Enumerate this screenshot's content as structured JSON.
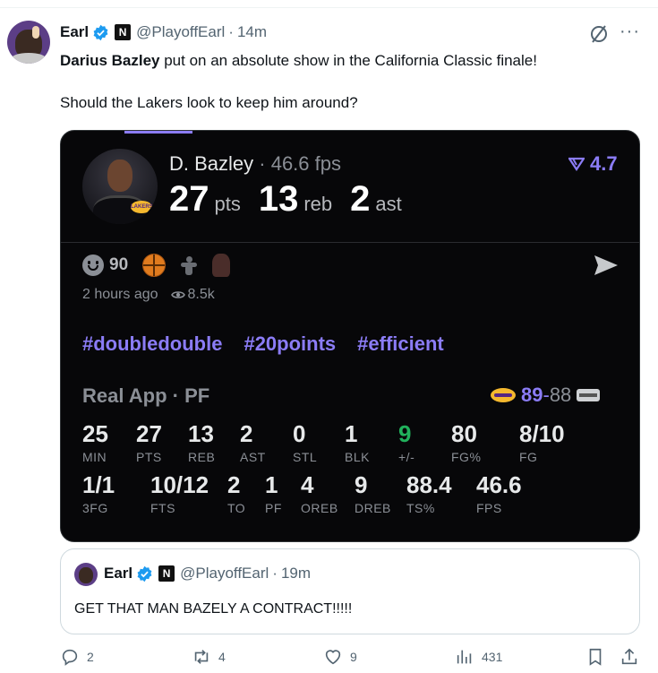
{
  "post": {
    "author": "Earl",
    "handle": "@PlayoffEarl",
    "dot": "·",
    "time": "14m",
    "badge_letter": "N",
    "text_bold": "Darius Bazley",
    "text_rest": " put on an absolute show in the California Classic finale!",
    "text_p2": "Should the Lakers look to keep him around?",
    "more": "···"
  },
  "card": {
    "player": "D. Bazley",
    "fps_label": " · 46.6 fps",
    "big": [
      {
        "num": "27",
        "lbl": "pts"
      },
      {
        "num": "13",
        "lbl": "reb"
      },
      {
        "num": "2",
        "lbl": "ast"
      }
    ],
    "rating": "4.7",
    "reaction_count": "90",
    "posted": "2 hours ago",
    "views": "8.5k",
    "tags": [
      "#doubledouble",
      "#20points",
      "#efficient"
    ],
    "source": "Real App · PF",
    "score_home": "89",
    "score_dash": "-",
    "score_away": "88",
    "row1": [
      {
        "v": "25",
        "k": "MIN"
      },
      {
        "v": "27",
        "k": "PTS"
      },
      {
        "v": "13",
        "k": "REB"
      },
      {
        "v": "2",
        "k": "AST"
      },
      {
        "v": "0",
        "k": "STL"
      },
      {
        "v": "1",
        "k": "BLK"
      },
      {
        "v": "9",
        "k": "+/-"
      },
      {
        "v": "80",
        "k": "FG%"
      },
      {
        "v": "8/10",
        "k": "FG"
      }
    ],
    "row2": [
      {
        "v": "1/1",
        "k": "3FG"
      },
      {
        "v": "10/12",
        "k": "FTS"
      },
      {
        "v": "2",
        "k": "TO"
      },
      {
        "v": "1",
        "k": "PF"
      },
      {
        "v": "4",
        "k": "OREB"
      },
      {
        "v": "9",
        "k": "DREB"
      },
      {
        "v": "88.4",
        "k": "TS%"
      },
      {
        "v": "46.6",
        "k": "FPS"
      }
    ]
  },
  "quote": {
    "author": "Earl",
    "handle": "@PlayoffEarl",
    "dot": "·",
    "time": "19m",
    "badge_letter": "N",
    "text": "GET THAT MAN BAZELY A CONTRACT!!!!!"
  },
  "actions": {
    "replies": "2",
    "reposts": "4",
    "likes": "9",
    "views": "431"
  },
  "colors": {
    "accent": "#8b7cf6",
    "verified": "#1d9bf0",
    "positive": "#21b15c",
    "card_bg": "#070709"
  },
  "icons": [
    "verified-badge-icon",
    "grok-icon",
    "more-icon",
    "rating-arrow-icon",
    "smile-icon",
    "basketball-icon",
    "send-icon",
    "eye-icon",
    "reply-icon",
    "repost-icon",
    "like-icon",
    "views-icon",
    "bookmark-icon",
    "share-icon"
  ]
}
